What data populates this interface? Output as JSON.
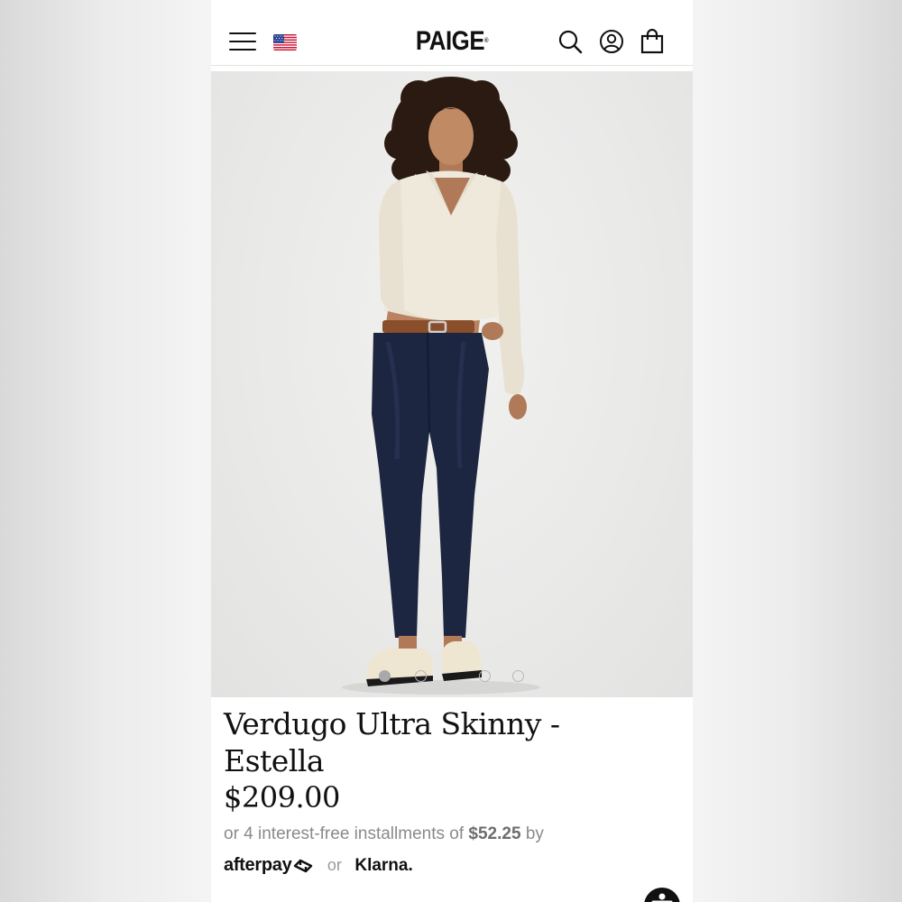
{
  "header": {
    "logo": "PAIGE",
    "logo_mark": "®",
    "menu_icon": "hamburger-menu-icon",
    "flag_icon": "us-flag-icon",
    "search_icon": "search-icon",
    "account_icon": "account-icon",
    "cart_icon": "shopping-bag-icon"
  },
  "hero": {
    "image_alt": "Model wearing cream v-neck sweater and dark wash skinny jeans",
    "slides": [
      1,
      2,
      3,
      4
    ],
    "active_slide": 1
  },
  "product": {
    "title": "Verdugo Ultra Skinny - Estella",
    "price": "$209.00"
  },
  "installments": {
    "prefix": "or 4 interest-free installments of",
    "amount": "$52.25",
    "suffix": "by"
  },
  "payment": {
    "afterpay_label": "afterpay",
    "or_label": "or",
    "klarna_label": "Klarna."
  },
  "colors": {
    "text": "#111111",
    "muted": "#8a8a8a",
    "hero_bg": "#e9e9e8",
    "denim": "#1d2640",
    "sweater": "#efe9dc"
  }
}
